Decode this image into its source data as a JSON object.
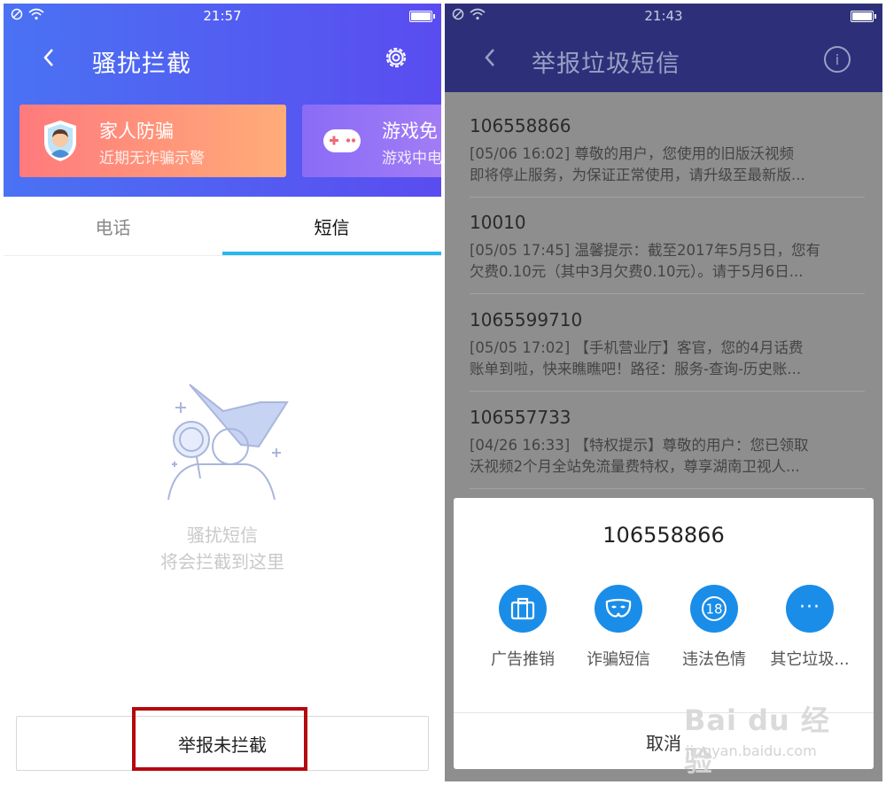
{
  "left": {
    "status_time": "21:57",
    "title": "骚扰拦截",
    "cards": [
      {
        "title": "家人防骗",
        "subtitle": "近期无诈骗示警"
      },
      {
        "title": "游戏免",
        "subtitle": "游戏中电"
      }
    ],
    "tabs": [
      {
        "label": "电话"
      },
      {
        "label": "短信"
      }
    ],
    "active_tab": "短信",
    "empty_line1": "骚扰短信",
    "empty_line2": "将会拦截到这里",
    "report_button": "举报未拦截"
  },
  "right": {
    "status_time": "21:43",
    "title": "举报垃圾短信",
    "info_icon_glyph": "i",
    "messages": [
      {
        "number": "106558866",
        "line1": "[05/06 16:02] 尊敬的用户，您使用的旧版沃视频",
        "line2": "即将停止服务，为保证正常使用，请升级至最新版..."
      },
      {
        "number": "10010",
        "line1": "[05/05 17:45] 温馨提示：截至2017年5月5日，您有",
        "line2": "欠费0.10元（其中3月欠费0.10元）。请于5月6日..."
      },
      {
        "number": "1065599710",
        "line1": "[05/05 17:02] 【手机营业厅】客官，您的4月话费",
        "line2": "账单到啦，快来瞧瞧吧！路径：服务-查询-历史账..."
      },
      {
        "number": "106557733",
        "line1": "[04/26 16:33] 【特权提示】尊敬的用户：您已领取",
        "line2": "沃视频2个月全站免流量费特权，尊享湖南卫视人..."
      }
    ],
    "sheet": {
      "number": "106558866",
      "options": [
        {
          "label": "广告推销",
          "icon": "briefcase-icon"
        },
        {
          "label": "诈骗短信",
          "icon": "mask-icon"
        },
        {
          "label": "违法色情",
          "icon": "eighteen-icon",
          "glyph": "18"
        },
        {
          "label": "其它垃圾...",
          "icon": "more-icon",
          "glyph": "···"
        }
      ],
      "cancel": "取消"
    }
  },
  "watermark": {
    "brand": "Bai du 经验",
    "url": "jingyan.baidu.com"
  },
  "colors": {
    "accent_blue": "#1a8de8",
    "tab_indicator": "#29b8ee",
    "highlight_red": "#b5080f",
    "header_dark": "#2d3079"
  }
}
